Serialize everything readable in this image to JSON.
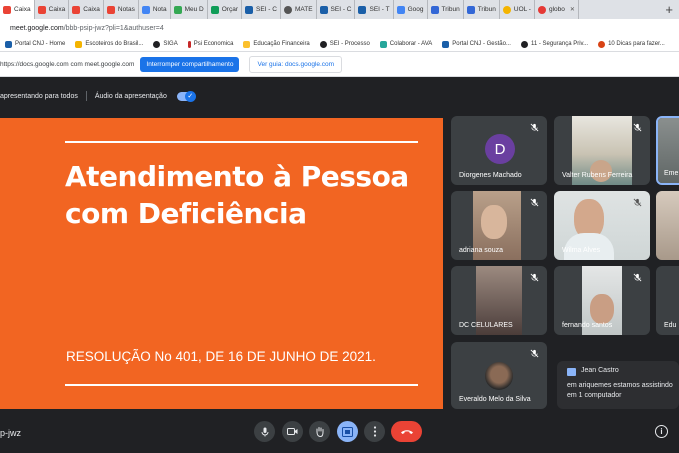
{
  "browser": {
    "tabs": [
      {
        "label": "Caixa",
        "color": "#ea4335"
      },
      {
        "label": "Caixa",
        "color": "#ea4335"
      },
      {
        "label": "Caixa",
        "color": "#ea4335"
      },
      {
        "label": "Notas",
        "color": "#ea4335"
      },
      {
        "label": "Nota",
        "color": "#4285f4"
      },
      {
        "label": "Meu D",
        "color": "#34a853"
      },
      {
        "label": "Orçar",
        "color": "#0f9d58"
      },
      {
        "label": "SEI - C",
        "color": "#1a5fa8"
      },
      {
        "label": "MATE",
        "color": "#555555"
      },
      {
        "label": "SEI - C",
        "color": "#1a5fa8"
      },
      {
        "label": "SEI - T",
        "color": "#1a5fa8"
      },
      {
        "label": "Goog",
        "color": "#4285f4"
      },
      {
        "label": "Tribun",
        "color": "#3367d6"
      },
      {
        "label": "Tribun",
        "color": "#3367d6"
      },
      {
        "label": "UOL -",
        "color": "#f4b400"
      },
      {
        "label": "globo",
        "color": "#e53935"
      }
    ],
    "new_tab_label": "+",
    "address": {
      "host": "meet.google.com",
      "path": "/bbb-psip-jwz?pli=1&authuser=4"
    },
    "bookmarks": [
      {
        "label": "Portal CNJ - Home",
        "color": "#1a5fa8"
      },
      {
        "label": "Escoteiros do Brasil...",
        "color": "#f4b400"
      },
      {
        "label": "SIGA",
        "color": "#202124"
      },
      {
        "label": "Psi Economica",
        "color": "#c62828"
      },
      {
        "label": "Educação Financeira",
        "color": "#fbc02d"
      },
      {
        "label": "SEI - Processo",
        "color": "#202124"
      },
      {
        "label": "Colaborar - AVA",
        "color": "#26a69a"
      },
      {
        "label": "Portal CNJ - Gestão...",
        "color": "#1a5fa8"
      },
      {
        "label": "11 - Segurança Priv...",
        "color": "#202124"
      },
      {
        "label": "10 Dicas para fazer...",
        "color": "#d84315"
      }
    ]
  },
  "sharebar": {
    "text": "https://docs.google.com com meet.google.com",
    "stop_label": "Interromper compartilhamento",
    "guide_label": "Ver guia: docs.google.com"
  },
  "presenting": {
    "status": "apresentando para todos",
    "audio_label": "Áudio da apresentação",
    "audio_on": true
  },
  "slide": {
    "title_line1": "Atendimento à Pessoa",
    "title_line2": "com Deficiência",
    "subtitle": "RESOLUÇÃO No 401, DE 16 DE JUNHO DE 2021.",
    "background": "#f26522"
  },
  "participants": [
    {
      "name": "Diorgenes Machado",
      "initial": "D",
      "muted": true
    },
    {
      "name": "Valter Rubens Ferreira",
      "muted": true
    },
    {
      "name": "Eme",
      "muted": false
    },
    {
      "name": "adriana souza",
      "muted": true
    },
    {
      "name": "Wilma Alves",
      "muted": true
    },
    {
      "name": "",
      "muted": false
    },
    {
      "name": "DC CELULARES",
      "muted": true
    },
    {
      "name": "fernando santos",
      "muted": true
    },
    {
      "name": "Edu",
      "muted": false
    },
    {
      "name": "Everaldo Melo da Silva",
      "muted": true
    }
  ],
  "chat": {
    "sender": "Jean Castro",
    "message": "em ariquemes estamos assistindo em 1 computador"
  },
  "meeting": {
    "code": "p-jwz",
    "controls": [
      "mic-icon",
      "camera-icon",
      "raise-hand-icon",
      "present-icon",
      "more-icon",
      "end-call-icon"
    ],
    "info_symbol": "i"
  }
}
